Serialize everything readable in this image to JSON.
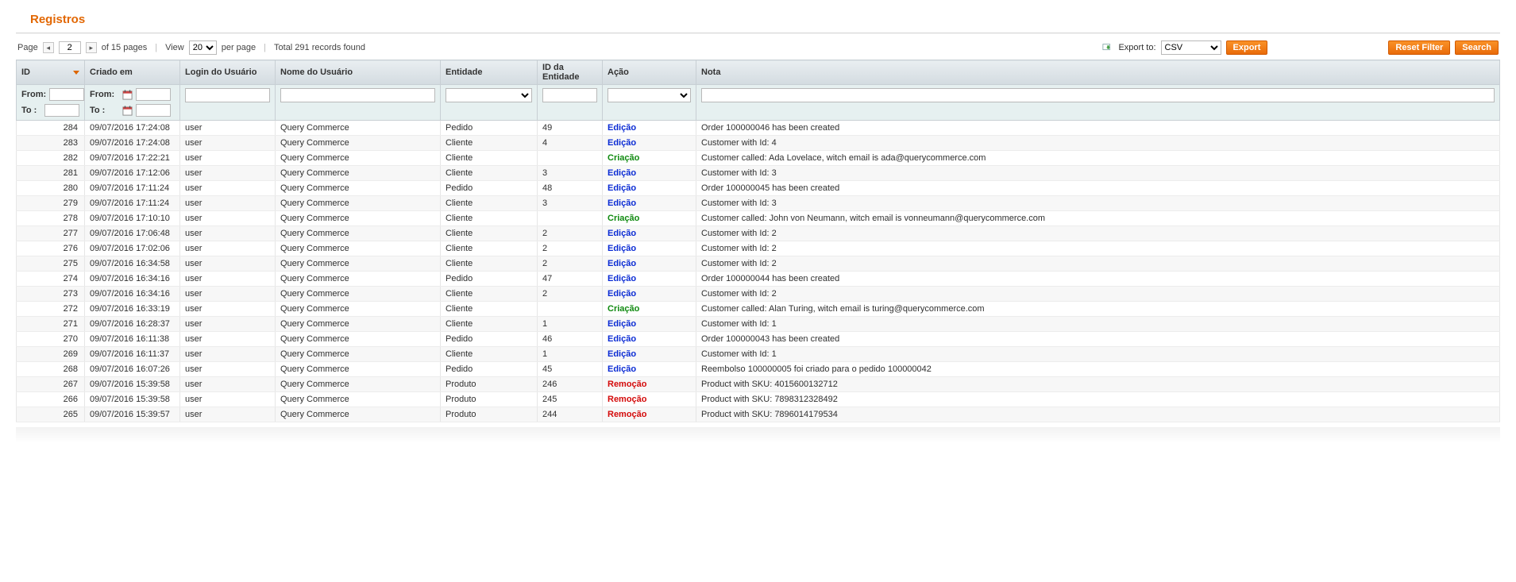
{
  "title": "Registros",
  "pager": {
    "page_label": "Page",
    "page_value": "2",
    "of_label": "of 15 pages",
    "view_label": "View",
    "view_value": "20",
    "per_page_label": "per page",
    "total_label": "Total 291 records found"
  },
  "export": {
    "label": "Export to:",
    "format": "CSV",
    "button": "Export"
  },
  "buttons": {
    "reset": "Reset Filter",
    "search": "Search"
  },
  "filters": {
    "from": "From:",
    "to": "To :"
  },
  "columns": {
    "id": "ID",
    "created": "Criado em",
    "login": "Login do Usuário",
    "name": "Nome do Usuário",
    "entity": "Entidade",
    "eid": "ID da Entidade",
    "action": "Ação",
    "note": "Nota"
  },
  "action_labels": {
    "edit": "Edição",
    "create": "Criação",
    "remove": "Remoção"
  },
  "rows": [
    {
      "id": "284",
      "created": "09/07/2016 17:24:08",
      "login": "user",
      "name": "Query Commerce",
      "entity": "Pedido",
      "eid": "49",
      "action": "edit",
      "note": "Order 100000046 has been created"
    },
    {
      "id": "283",
      "created": "09/07/2016 17:24:08",
      "login": "user",
      "name": "Query Commerce",
      "entity": "Cliente",
      "eid": "4",
      "action": "edit",
      "note": "Customer with Id: 4"
    },
    {
      "id": "282",
      "created": "09/07/2016 17:22:21",
      "login": "user",
      "name": "Query Commerce",
      "entity": "Cliente",
      "eid": "",
      "action": "create",
      "note": "Customer called: Ada Lovelace, witch email is ada@querycommerce.com"
    },
    {
      "id": "281",
      "created": "09/07/2016 17:12:06",
      "login": "user",
      "name": "Query Commerce",
      "entity": "Cliente",
      "eid": "3",
      "action": "edit",
      "note": "Customer with Id: 3"
    },
    {
      "id": "280",
      "created": "09/07/2016 17:11:24",
      "login": "user",
      "name": "Query Commerce",
      "entity": "Pedido",
      "eid": "48",
      "action": "edit",
      "note": "Order 100000045 has been created"
    },
    {
      "id": "279",
      "created": "09/07/2016 17:11:24",
      "login": "user",
      "name": "Query Commerce",
      "entity": "Cliente",
      "eid": "3",
      "action": "edit",
      "note": "Customer with Id: 3"
    },
    {
      "id": "278",
      "created": "09/07/2016 17:10:10",
      "login": "user",
      "name": "Query Commerce",
      "entity": "Cliente",
      "eid": "",
      "action": "create",
      "note": "Customer called: John von Neumann, witch email is vonneumann@querycommerce.com"
    },
    {
      "id": "277",
      "created": "09/07/2016 17:06:48",
      "login": "user",
      "name": "Query Commerce",
      "entity": "Cliente",
      "eid": "2",
      "action": "edit",
      "note": "Customer with Id: 2"
    },
    {
      "id": "276",
      "created": "09/07/2016 17:02:06",
      "login": "user",
      "name": "Query Commerce",
      "entity": "Cliente",
      "eid": "2",
      "action": "edit",
      "note": "Customer with Id: 2"
    },
    {
      "id": "275",
      "created": "09/07/2016 16:34:58",
      "login": "user",
      "name": "Query Commerce",
      "entity": "Cliente",
      "eid": "2",
      "action": "edit",
      "note": "Customer with Id: 2"
    },
    {
      "id": "274",
      "created": "09/07/2016 16:34:16",
      "login": "user",
      "name": "Query Commerce",
      "entity": "Pedido",
      "eid": "47",
      "action": "edit",
      "note": "Order 100000044 has been created"
    },
    {
      "id": "273",
      "created": "09/07/2016 16:34:16",
      "login": "user",
      "name": "Query Commerce",
      "entity": "Cliente",
      "eid": "2",
      "action": "edit",
      "note": "Customer with Id: 2"
    },
    {
      "id": "272",
      "created": "09/07/2016 16:33:19",
      "login": "user",
      "name": "Query Commerce",
      "entity": "Cliente",
      "eid": "",
      "action": "create",
      "note": "Customer called: Alan Turing, witch email is turing@querycommerce.com"
    },
    {
      "id": "271",
      "created": "09/07/2016 16:28:37",
      "login": "user",
      "name": "Query Commerce",
      "entity": "Cliente",
      "eid": "1",
      "action": "edit",
      "note": "Customer with Id: 1"
    },
    {
      "id": "270",
      "created": "09/07/2016 16:11:38",
      "login": "user",
      "name": "Query Commerce",
      "entity": "Pedido",
      "eid": "46",
      "action": "edit",
      "note": "Order 100000043 has been created"
    },
    {
      "id": "269",
      "created": "09/07/2016 16:11:37",
      "login": "user",
      "name": "Query Commerce",
      "entity": "Cliente",
      "eid": "1",
      "action": "edit",
      "note": "Customer with Id: 1"
    },
    {
      "id": "268",
      "created": "09/07/2016 16:07:26",
      "login": "user",
      "name": "Query Commerce",
      "entity": "Pedido",
      "eid": "45",
      "action": "edit",
      "note": "Reembolso 100000005 foi criado para o pedido 100000042"
    },
    {
      "id": "267",
      "created": "09/07/2016 15:39:58",
      "login": "user",
      "name": "Query Commerce",
      "entity": "Produto",
      "eid": "246",
      "action": "remove",
      "note": "Product with SKU: 4015600132712"
    },
    {
      "id": "266",
      "created": "09/07/2016 15:39:58",
      "login": "user",
      "name": "Query Commerce",
      "entity": "Produto",
      "eid": "245",
      "action": "remove",
      "note": "Product with SKU: 7898312328492"
    },
    {
      "id": "265",
      "created": "09/07/2016 15:39:57",
      "login": "user",
      "name": "Query Commerce",
      "entity": "Produto",
      "eid": "244",
      "action": "remove",
      "note": "Product with SKU: 7896014179534"
    }
  ]
}
